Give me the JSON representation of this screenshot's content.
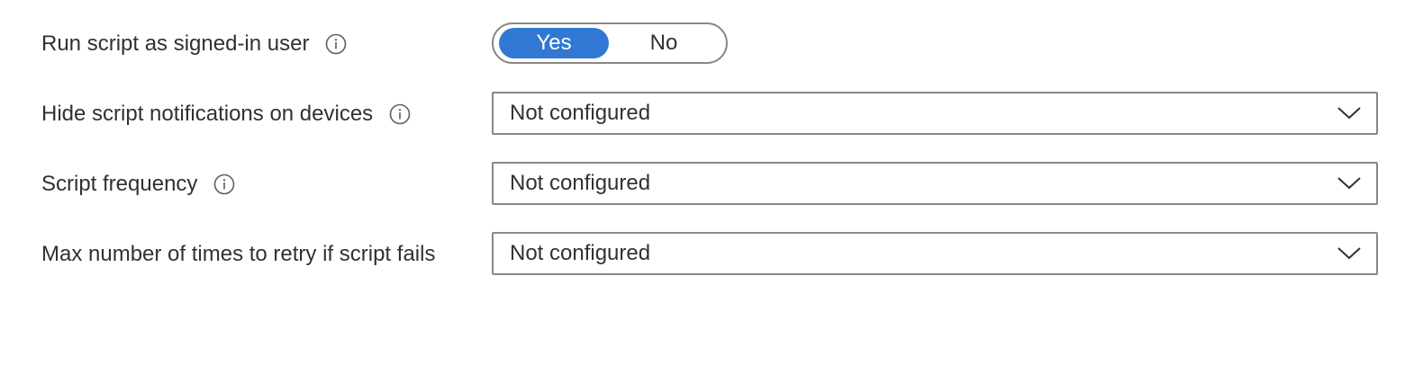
{
  "settings": {
    "run_as_user": {
      "label": "Run script as signed-in user",
      "info_icon": "info-icon",
      "options": [
        "Yes",
        "No"
      ],
      "selected": "Yes"
    },
    "hide_notifications": {
      "label": "Hide script notifications on devices",
      "info_icon": "info-icon",
      "value": "Not configured"
    },
    "frequency": {
      "label": "Script frequency",
      "info_icon": "info-icon",
      "value": "Not configured"
    },
    "max_retries": {
      "label": "Max number of times to retry if script fails",
      "value": "Not configured"
    }
  },
  "colors": {
    "accent": "#3078d4",
    "border": "#8a8886",
    "text": "#323130"
  },
  "icons": {
    "info": "info-icon",
    "dropdown": "chevron-down-icon"
  }
}
